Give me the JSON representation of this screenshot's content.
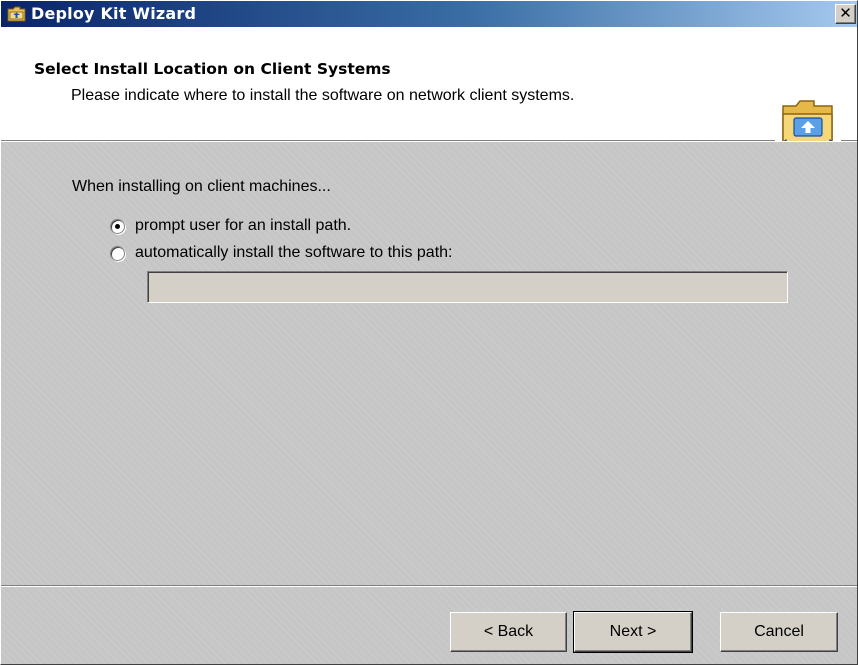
{
  "window": {
    "title": "Deploy Kit Wizard",
    "close_glyph": "✕",
    "icon": "wizard-folder-icon"
  },
  "header": {
    "title": "Select Install Location on Client Systems",
    "subtitle": "Please indicate where to install the software on network client systems.",
    "icon": "folder-network-icon"
  },
  "content": {
    "prompt": "When installing on client machines...",
    "options": [
      {
        "label": "prompt user for an install path.",
        "checked": true
      },
      {
        "label": "automatically install the software to this path:",
        "checked": false
      }
    ],
    "path_value": ""
  },
  "buttons": {
    "back": "< Back",
    "next": "Next >",
    "cancel": "Cancel"
  },
  "colors": {
    "titlebar_start": "#0a246a",
    "titlebar_end": "#a6caf0",
    "face": "#d4d0c8",
    "header_bg": "#ffffff"
  }
}
